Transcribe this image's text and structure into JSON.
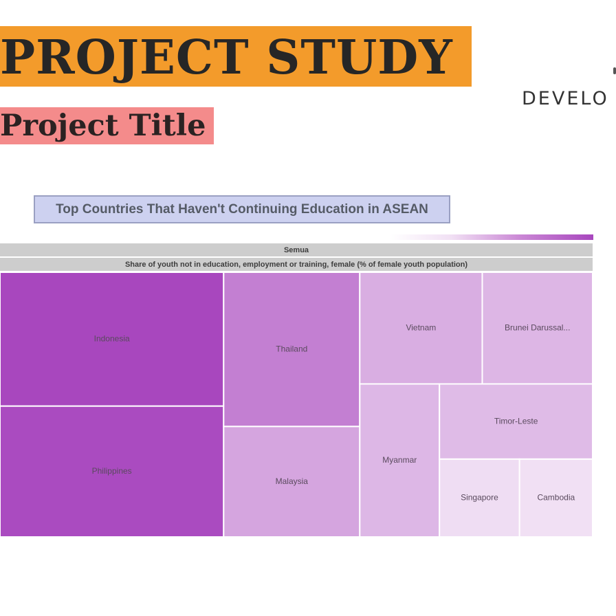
{
  "header": {
    "main_title": "PROJECT STUDY",
    "subtitle": "Project Title",
    "side_text": "DEVELO",
    "band_color": "#f39b2b",
    "subtitle_color": "#f48b8b"
  },
  "chart_data": {
    "type": "treemap",
    "title": "Top Countries That Haven't Continuing Education in ASEAN",
    "root_label": "Semua",
    "series_label": "Share of youth not in education, employment or training, female (% of female youth population)",
    "color_scale": {
      "low": "#f1e0f4",
      "high": "#a847be"
    },
    "items": [
      {
        "label": "Indonesia",
        "value": 22.1
      },
      {
        "label": "Philippines",
        "value": 21.6
      },
      {
        "label": "Thailand",
        "value": 15.5
      },
      {
        "label": "Malaysia",
        "value": 11.1
      },
      {
        "label": "Vietnam",
        "value": 10.1
      },
      {
        "label": "Brunei Darussal...",
        "value": 9.1
      },
      {
        "label": "Myanmar",
        "value": 9.0
      },
      {
        "label": "Timor-Leste",
        "value": 8.5
      },
      {
        "label": "Singapore",
        "value": 4.6
      },
      {
        "label": "Cambodia",
        "value": 4.2
      }
    ]
  }
}
